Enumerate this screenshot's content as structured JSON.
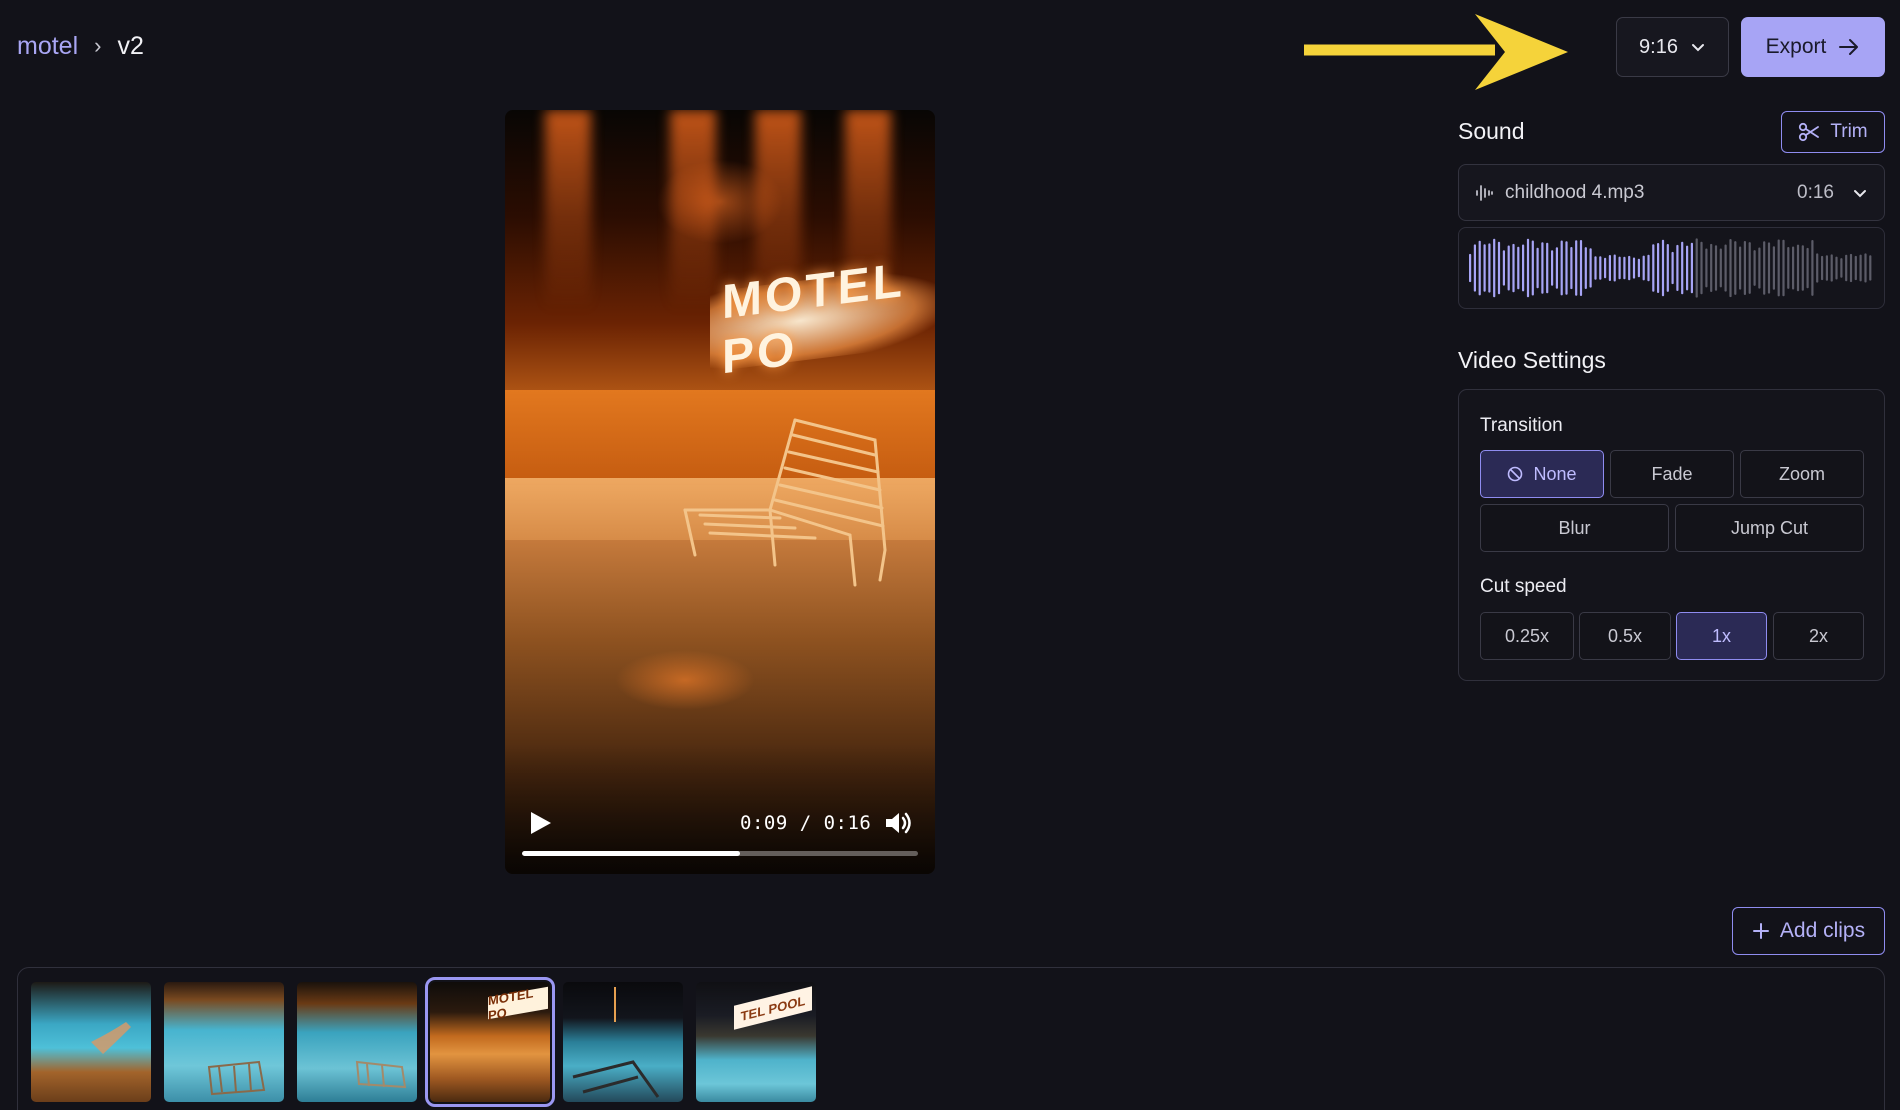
{
  "header": {
    "project": "motel",
    "separator": "›",
    "version": "v2",
    "aspect_ratio": "9:16",
    "export_label": "Export"
  },
  "player": {
    "current_time": "0:09",
    "duration": "0:16",
    "timecode": "0:09 / 0:16",
    "progress": 0.55,
    "sign_text": "MOTEL PO"
  },
  "sound": {
    "title": "Sound",
    "trim_label": "Trim",
    "file_name": "childhood 4.mp3",
    "duration": "0:16",
    "played_fraction": 0.55
  },
  "video_settings": {
    "title": "Video Settings",
    "transition": {
      "label": "Transition",
      "options": [
        "None",
        "Fade",
        "Zoom",
        "Blur",
        "Jump Cut"
      ],
      "selected": "None"
    },
    "cut_speed": {
      "label": "Cut speed",
      "options": [
        "0.25x",
        "0.5x",
        "1x",
        "2x"
      ],
      "selected": "1x"
    }
  },
  "clips": {
    "add_label": "Add clips",
    "count": 6,
    "selected_index": 3,
    "thumb_texts": [
      "MOTEL PO",
      "TEL POOL"
    ]
  },
  "colors": {
    "accent": "#a7a4f5",
    "annotation_arrow": "#f5d33a",
    "background": "#121219"
  }
}
